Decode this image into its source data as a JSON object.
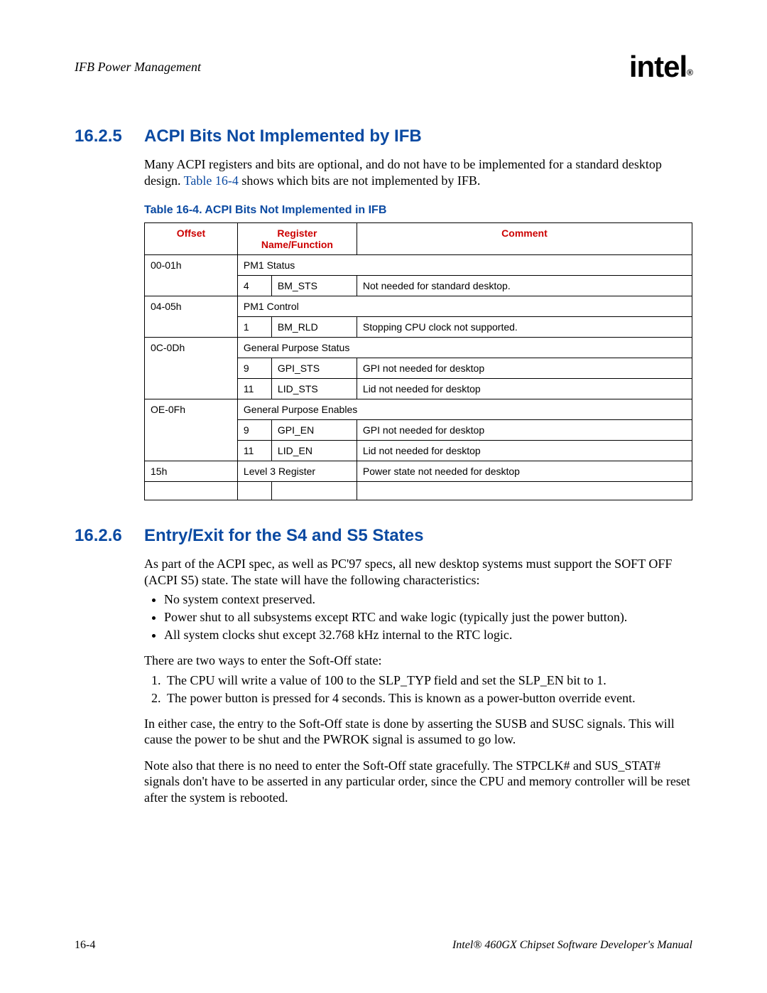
{
  "header": {
    "chapter": "IFB Power Management",
    "logo_text": "intel",
    "logo_r": "®"
  },
  "section1": {
    "num": "16.2.5",
    "title": "ACPI Bits Not Implemented by IFB",
    "para_pre": "Many ACPI registers and bits are optional, and do not have to be implemented for a standard desktop design. ",
    "para_link": "Table 16-4",
    "para_post": " shows which bits are not implemented by IFB.",
    "table_caption": "Table 16-4. ACPI Bits Not Implemented in IFB"
  },
  "table": {
    "headers": {
      "offset": "Offset",
      "name": "Register Name/Function",
      "comment": "Comment"
    },
    "chart_data": {
      "type": "table",
      "rows": [
        {
          "offset": "00-01h",
          "group": "PM1 Status"
        },
        {
          "bit": "4",
          "name": "BM_STS",
          "comment": "Not needed for standard desktop."
        },
        {
          "offset": "04-05h",
          "group": "PM1 Control"
        },
        {
          "bit": "1",
          "name": "BM_RLD",
          "comment": "Stopping CPU clock not supported."
        },
        {
          "offset": "0C-0Dh",
          "group": "General Purpose Status"
        },
        {
          "bit": "9",
          "name": "GPI_STS",
          "comment": "GPI not needed for desktop"
        },
        {
          "bit": "11",
          "name": "LID_STS",
          "comment": "Lid not needed for desktop"
        },
        {
          "offset": "OE-0Fh",
          "group": "General Purpose Enables"
        },
        {
          "bit": "9",
          "name": "GPI_EN",
          "comment": "GPI not needed for desktop"
        },
        {
          "bit": "11",
          "name": "LID_EN",
          "comment": "Lid not needed for desktop"
        },
        {
          "offset": "15h",
          "name_span": "Level 3 Register",
          "comment": "Power state not needed for desktop"
        }
      ]
    }
  },
  "section2": {
    "num": "16.2.6",
    "title": "Entry/Exit for the S4 and S5 States",
    "para1": "As part of the ACPI spec, as well as PC'97 specs, all new desktop systems must support the SOFT OFF (ACPI S5) state. The state will have the following characteristics:",
    "bullets": [
      "No system context preserved.",
      "Power shut to all subsystems except RTC and wake logic (typically just the power button).",
      "All system clocks shut except 32.768 kHz internal to the RTC logic."
    ],
    "para2": "There are two ways to enter the Soft-Off state:",
    "numbered": [
      "The CPU will write a value of 100 to the SLP_TYP field and set the SLP_EN bit to 1.",
      "The power button is pressed for 4 seconds. This is known as a power-button override event."
    ],
    "para3": "In either case, the entry to the Soft-Off state is done by asserting the SUSB and SUSC signals. This will cause the power to be shut and the PWROK signal is assumed to go low.",
    "para4": "Note also that there is no need to enter the Soft-Off state gracefully. The STPCLK# and SUS_STAT# signals don't have to be asserted in any particular order, since the CPU and memory controller will be reset after the system is rebooted."
  },
  "footer": {
    "page": "16-4",
    "manual": "Intel® 460GX Chipset Software Developer's Manual"
  }
}
